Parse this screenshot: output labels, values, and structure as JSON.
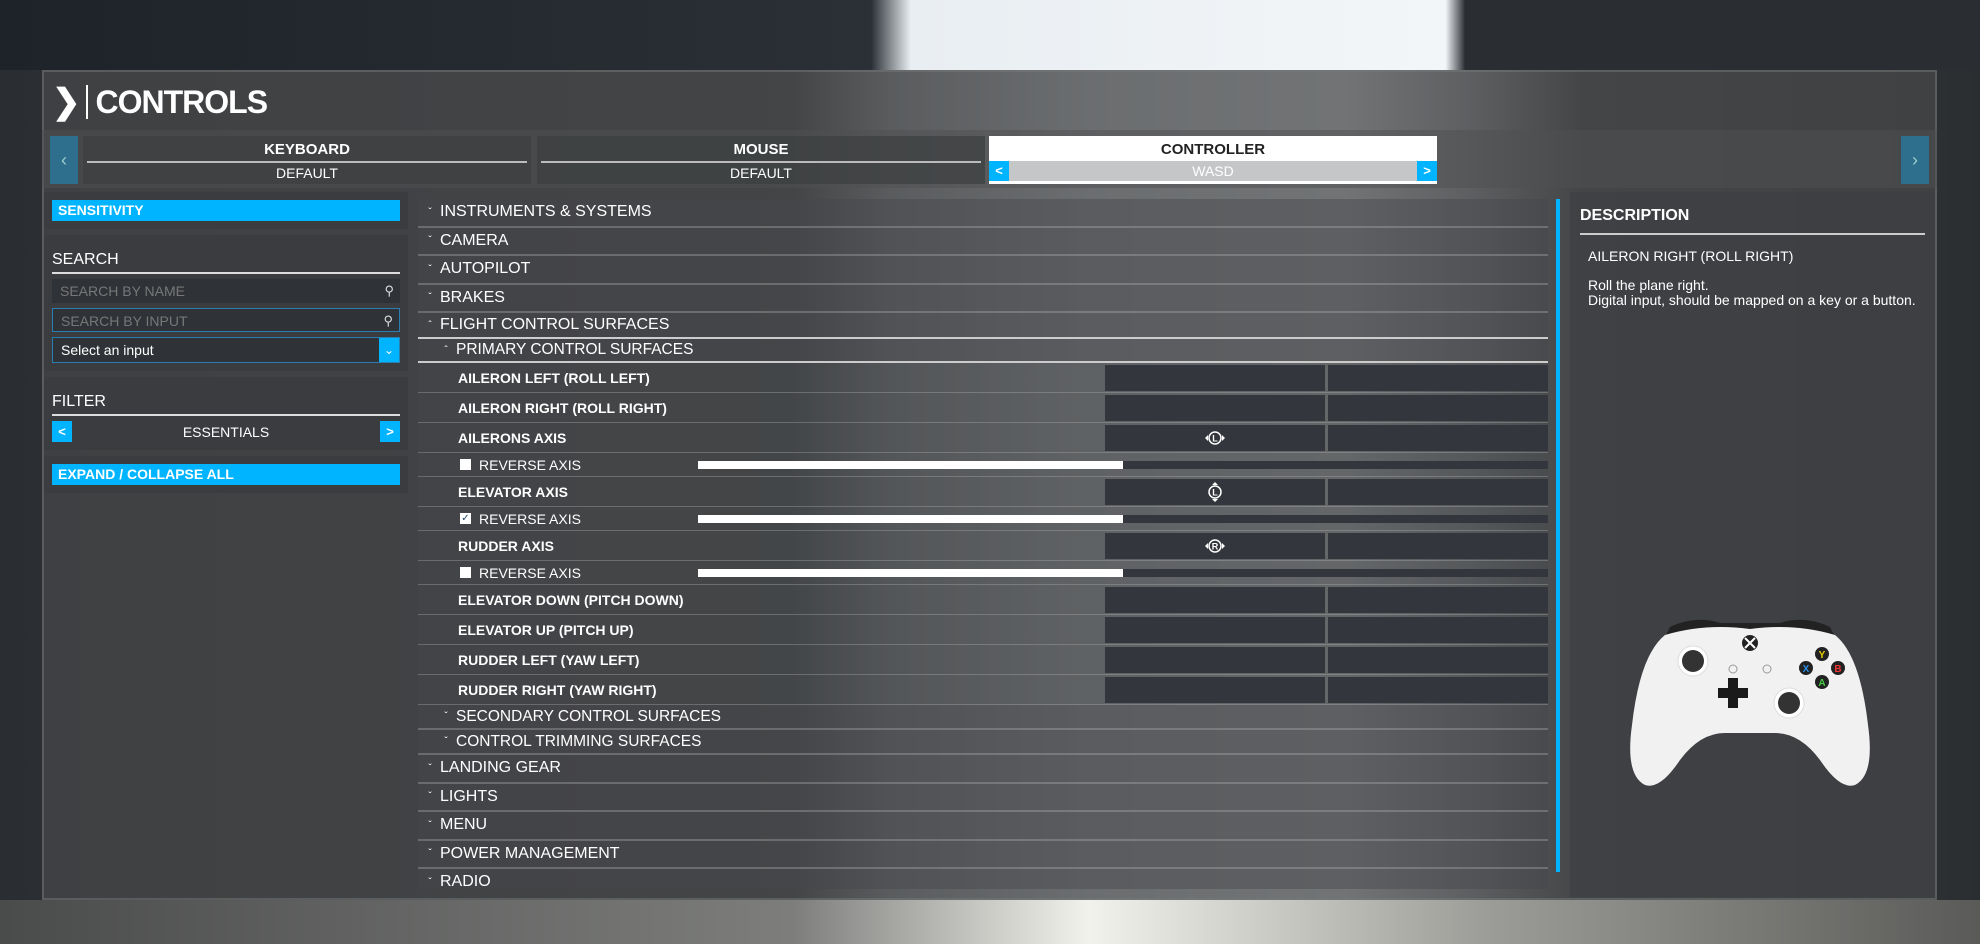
{
  "header": {
    "title": "CONTROLS"
  },
  "tabs": [
    {
      "label": "KEYBOARD",
      "profile": "DEFAULT",
      "active": false
    },
    {
      "label": "MOUSE",
      "profile": "DEFAULT",
      "active": false
    },
    {
      "label": "CONTROLLER",
      "profile": "WASD",
      "active": true
    }
  ],
  "sidebar": {
    "sensitivity_label": "SENSITIVITY",
    "search_heading": "SEARCH",
    "search_name_placeholder": "SEARCH BY NAME",
    "search_input_placeholder": "SEARCH BY INPUT",
    "select_value": "Select an input",
    "filter_heading": "FILTER",
    "filter_value": "ESSENTIALS",
    "expand_label": "EXPAND / COLLAPSE ALL"
  },
  "list": {
    "top_categories": [
      "INSTRUMENTS & SYSTEMS",
      "CAMERA",
      "AUTOPILOT",
      "BRAKES"
    ],
    "open_category": "FLIGHT CONTROL SURFACES",
    "open_sub": "PRIMARY CONTROL SURFACES",
    "items": {
      "aileron_left": "AILERON LEFT (ROLL LEFT)",
      "aileron_right": "AILERON RIGHT (ROLL RIGHT)",
      "ailerons_axis": "AILERONS AXIS",
      "elevator_axis": "ELEVATOR AXIS",
      "rudder_axis": "RUDDER AXIS",
      "elevator_down": "ELEVATOR DOWN (PITCH DOWN)",
      "elevator_up": "ELEVATOR UP (PITCH UP)",
      "rudder_left": "RUDDER LEFT (YAW LEFT)",
      "rudder_right": "RUDDER RIGHT (YAW RIGHT)"
    },
    "reverse_label": "REVERSE AXIS",
    "axes": {
      "ailerons": {
        "stick": "L",
        "reversed": false,
        "level_percent": 50
      },
      "elevator": {
        "stick": "L",
        "reversed": true,
        "level_percent": 50
      },
      "rudder": {
        "stick": "R",
        "reversed": false,
        "level_percent": 50
      }
    },
    "closed_subs": [
      "SECONDARY CONTROL SURFACES",
      "CONTROL TRIMMING SURFACES"
    ],
    "bottom_categories": [
      "LANDING GEAR",
      "LIGHTS",
      "MENU",
      "POWER MANAGEMENT",
      "RADIO"
    ]
  },
  "description": {
    "heading": "DESCRIPTION",
    "title": "AILERON RIGHT (ROLL RIGHT)",
    "line1": "Roll the plane right.",
    "line2": "Digital input, should be mapped on a key or a button."
  },
  "colors": {
    "accent": "#00b4ff"
  }
}
